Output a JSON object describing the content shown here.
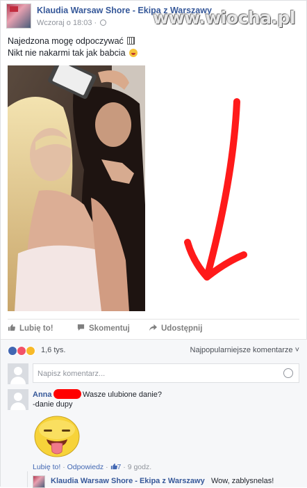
{
  "post": {
    "page_name": "Klaudia Warsaw Shore - Ekipa z Warszawy",
    "timestamp": "Wczoraj o 18:03",
    "separator": "·",
    "watermark": "www.wiocha.pl",
    "text_line1": "Najedzona mogę odpoczywać",
    "text_line2": "Nikt nie nakarmi tak jak babcia",
    "arrow_color": "#ff1a1a"
  },
  "actions": {
    "like": "Lubię to!",
    "comment": "Skomentuj",
    "share": "Udostępnij"
  },
  "reactions": {
    "count": "1,6 tys.",
    "top_comments": "Najpopularniejsze komentarze ˅",
    "icons": [
      "like-reaction-icon",
      "love-reaction-icon",
      "haha-reaction-icon"
    ]
  },
  "composer": {
    "placeholder": "Napisz komentarz..."
  },
  "comment": {
    "author": "Anna C",
    "text_line1": "Wasze ulubione danie?",
    "text_line2": "-danie dupy",
    "like_link": "Lubię to!",
    "reply_link": "Odpowiedz",
    "likes": "7",
    "time": "9 godz.",
    "dot": "·"
  },
  "reply": {
    "author": "Klaudia Warsaw Shore - Ekipa z Warszawy",
    "text": "Wow, zablysnelas!"
  },
  "colors": {
    "link_blue": "#365899",
    "like_blue": "#4267b2",
    "love_red": "#f25268",
    "haha_yellow": "#f7b928"
  }
}
